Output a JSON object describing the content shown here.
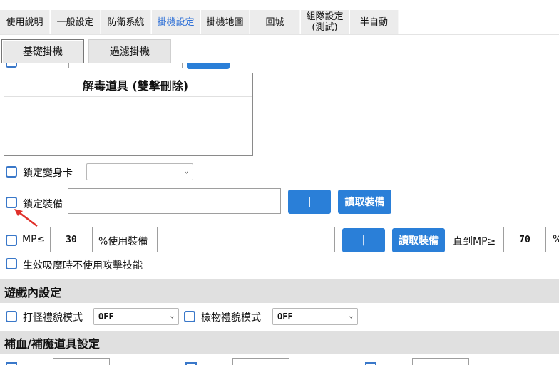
{
  "top_tabs": [
    {
      "label": "使用說明"
    },
    {
      "label": "一般設定"
    },
    {
      "label": "防衛系統"
    },
    {
      "label": "掛機設定"
    },
    {
      "label": "掛機地圖"
    },
    {
      "label": "回城"
    },
    {
      "label": "組隊設定\n(測試)"
    },
    {
      "label": "半自動"
    }
  ],
  "sub_tabs": [
    {
      "label": "基礎掛機"
    },
    {
      "label": "過濾掛機"
    }
  ],
  "antidote_table": {
    "header": "解毒道具 (雙擊刪除)"
  },
  "lock_transform": {
    "label": "鎖定變身卡",
    "selected": ""
  },
  "lock_equipment": {
    "label": "鎖定裝備",
    "value": "",
    "pipe_label": "|",
    "read_label": "讀取裝備"
  },
  "mp_row": {
    "mp_label": "MP≤",
    "mp_value": "30",
    "use_equip_label": "%使用裝備",
    "value": "",
    "pipe_label": "|",
    "read_label": "讀取裝備",
    "until_label": "直到MP≥",
    "until_value": "70",
    "percent": "%"
  },
  "no_attack_skill": {
    "label": "生效吸魔時不使用攻擊技能"
  },
  "ingame_section": {
    "title": "遊戲內設定"
  },
  "fight_courtesy": {
    "label": "打怪禮貌模式",
    "selected": "OFF"
  },
  "pickup_courtesy": {
    "label": "檢物禮貌模式",
    "selected": "OFF"
  },
  "heal_section": {
    "title": "補血/補魔道具設定"
  }
}
